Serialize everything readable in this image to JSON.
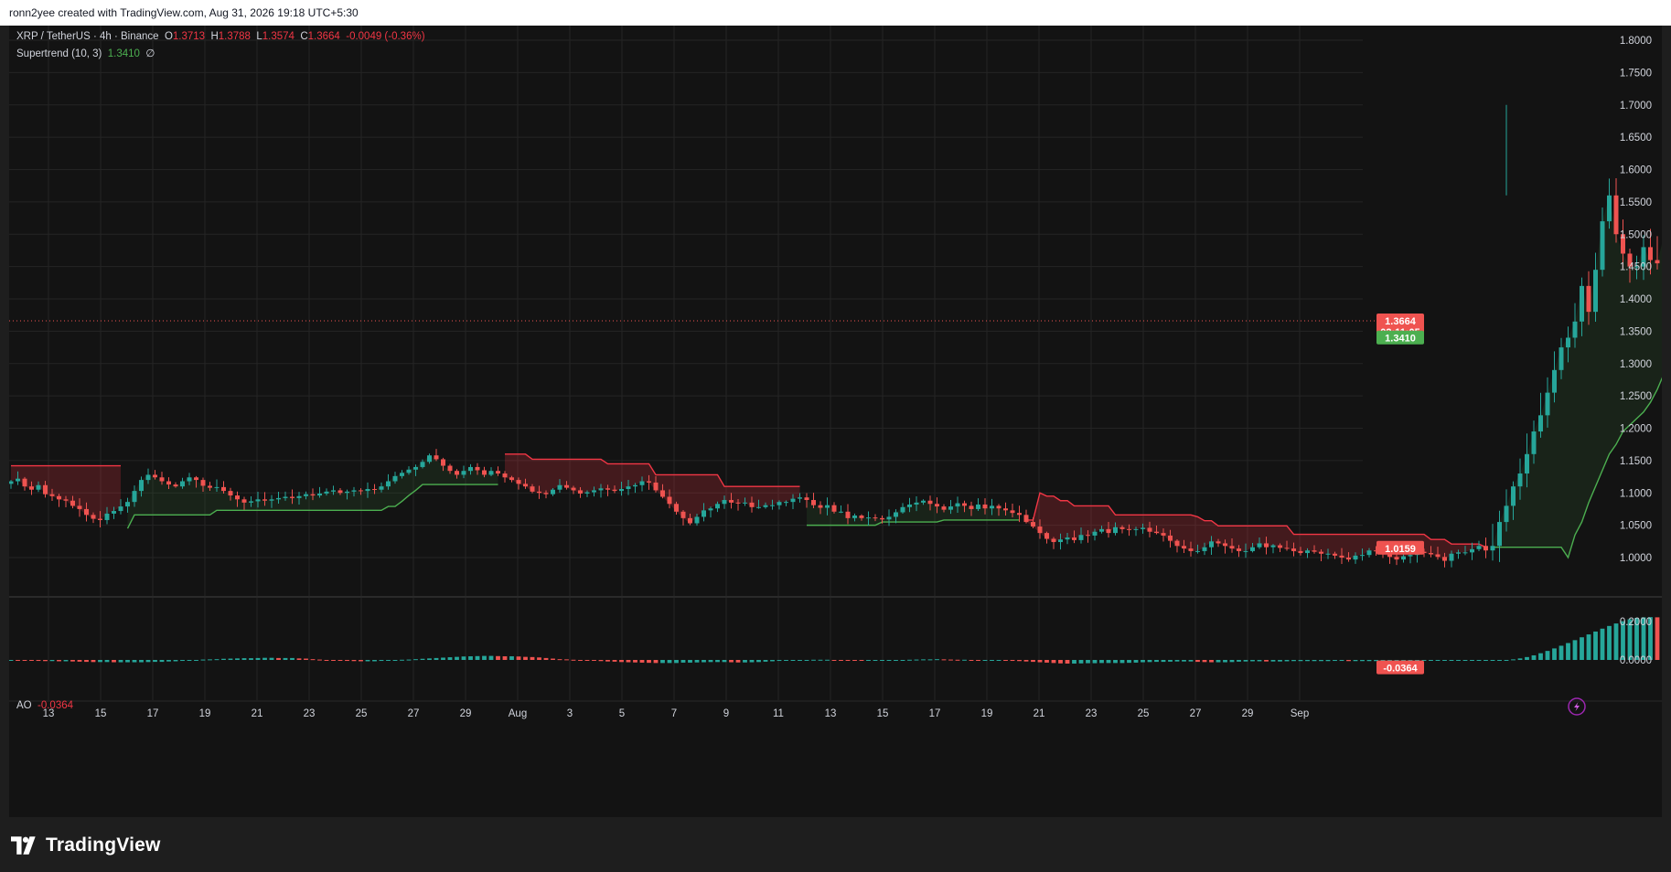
{
  "header": {
    "attribution": "ronn2yee created with TradingView.com, Aug 31, 2026 19:18 UTC+5:30"
  },
  "legend": {
    "symbol": "XRP / TetherUS · 4h · Binance",
    "open_label": "O",
    "open": "1.3713",
    "high_label": "H",
    "high": "1.3788",
    "low_label": "L",
    "low": "1.3574",
    "close_label": "C",
    "close": "1.3664",
    "change": "-0.0049 (-0.36%)",
    "indicator": "Supertrend (10, 3)",
    "indicator_value": "1.3410",
    "indicator_extra": "∅",
    "ao_label": "AO",
    "ao_value": "-0.0364"
  },
  "price_axis": {
    "ticks": [
      "1.8000",
      "1.7500",
      "1.7000",
      "1.6500",
      "1.6000",
      "1.5500",
      "1.5000",
      "1.4500",
      "1.4000",
      "1.3500",
      "1.3000",
      "1.2500",
      "1.2000",
      "1.1500",
      "1.1000",
      "1.0500",
      "1.0000"
    ],
    "last_price_label": "1.3664",
    "countdown": "02:11:05",
    "supertrend_label": "1.3410",
    "low_marker_label": "1.0159"
  },
  "ao_axis": {
    "ticks": [
      "0.2000",
      "0.0000"
    ],
    "current_label": "-0.0364"
  },
  "time_axis": {
    "labels": [
      "13",
      "15",
      "17",
      "19",
      "21",
      "23",
      "25",
      "27",
      "29",
      "Aug",
      "3",
      "5",
      "7",
      "9",
      "11",
      "13",
      "15",
      "17",
      "19",
      "21",
      "23",
      "25",
      "27",
      "29",
      "Sep"
    ]
  },
  "colors": {
    "up": "#26a69a",
    "down": "#ef5350",
    "supertrend_up": "#4caf50",
    "supertrend_down": "#f23645",
    "background": "#131313"
  },
  "brand": {
    "name": "TradingView"
  },
  "chart_data": {
    "type": "candlestick",
    "symbol": "XRP / TetherUS",
    "interval": "4h",
    "exchange": "Binance",
    "x_start": "Jul 12",
    "x_end": "Aug 31",
    "ylim": [
      0.95,
      1.82
    ],
    "series": [
      {
        "name": "XRP / TetherUS",
        "close": [
          1.118,
          1.122,
          1.11,
          1.105,
          1.112,
          1.098,
          1.095,
          1.09,
          1.088,
          1.08,
          1.075,
          1.066,
          1.06,
          1.058,
          1.068,
          1.072,
          1.079,
          1.086,
          1.103,
          1.12,
          1.128,
          1.124,
          1.118,
          1.113,
          1.11,
          1.118,
          1.124,
          1.12,
          1.111,
          1.108,
          1.109,
          1.103,
          1.096,
          1.09,
          1.085,
          1.087,
          1.09,
          1.088,
          1.09,
          1.092,
          1.094,
          1.092,
          1.095,
          1.098,
          1.096,
          1.099,
          1.102,
          1.104,
          1.1,
          1.102,
          1.104,
          1.103,
          1.106,
          1.105,
          1.11,
          1.118,
          1.126,
          1.131,
          1.136,
          1.14,
          1.148,
          1.158,
          1.152,
          1.142,
          1.134,
          1.128,
          1.134,
          1.14,
          1.135,
          1.128,
          1.134,
          1.13,
          1.124,
          1.12,
          1.114,
          1.11,
          1.102,
          1.1,
          1.098,
          1.105,
          1.112,
          1.108,
          1.104,
          1.099,
          1.101,
          1.104,
          1.107,
          1.105,
          1.103,
          1.106,
          1.11,
          1.112,
          1.118,
          1.116,
          1.104,
          1.094,
          1.083,
          1.071,
          1.061,
          1.053,
          1.063,
          1.073,
          1.076,
          1.083,
          1.089,
          1.085,
          1.084,
          1.085,
          1.078,
          1.078,
          1.081,
          1.081,
          1.086,
          1.086,
          1.091,
          1.093,
          1.089,
          1.081,
          1.077,
          1.081,
          1.071,
          1.071,
          1.061,
          1.065,
          1.061,
          1.062,
          1.061,
          1.059,
          1.063,
          1.07,
          1.078,
          1.082,
          1.085,
          1.088,
          1.083,
          1.079,
          1.074,
          1.079,
          1.084,
          1.08,
          1.075,
          1.082,
          1.076,
          1.08,
          1.076,
          1.073,
          1.069,
          1.066,
          1.055,
          1.048,
          1.038,
          1.029,
          1.024,
          1.028,
          1.031,
          1.027,
          1.035,
          1.034,
          1.04,
          1.044,
          1.038,
          1.047,
          1.044,
          1.043,
          1.044,
          1.046,
          1.04,
          1.038,
          1.034,
          1.026,
          1.018,
          1.014,
          1.01,
          1.01,
          1.016,
          1.025,
          1.022,
          1.018,
          1.014,
          1.01,
          1.01,
          1.016,
          1.022,
          1.016,
          1.019,
          1.015,
          1.014,
          1.01,
          1.007,
          1.011,
          1.009,
          1.006,
          1.006,
          1.003,
          1.0,
          0.997,
          1.003,
          1.004,
          1.011,
          1.01,
          1.005,
          1.001,
          0.997,
          1.002,
          1.004,
          1.009,
          1.007,
          1.005,
          1.001,
          0.995,
          1.006,
          1.008,
          1.008,
          1.013,
          1.018,
          1.011,
          1.018,
          1.055,
          1.08,
          1.11,
          1.13,
          1.16,
          1.195,
          1.22,
          1.255,
          1.29,
          1.325,
          1.34,
          1.365,
          1.42,
          1.38,
          1.445,
          1.52,
          1.56,
          1.5,
          1.47,
          1.45,
          1.45,
          1.48,
          1.46,
          1.455,
          1.5,
          1.475,
          1.48,
          1.51,
          1.48,
          1.51,
          1.495,
          1.52,
          1.5,
          1.52,
          1.49,
          1.48,
          1.465,
          1.462,
          1.42,
          1.41,
          1.39,
          1.38,
          1.35,
          1.365,
          1.39,
          1.4,
          1.42,
          1.46,
          1.47,
          1.45,
          1.44,
          1.43,
          1.4,
          1.37,
          1.38,
          1.385,
          1.378,
          1.385,
          1.39,
          1.38,
          1.395,
          1.4,
          1.398,
          1.403,
          1.395,
          1.405,
          1.385,
          1.41,
          1.355,
          1.35,
          1.36,
          1.371,
          1.366
        ]
      },
      {
        "name": "Supertrend (10, 3)",
        "values": [
          1.142,
          1.142,
          1.142,
          1.142,
          1.142,
          1.142,
          1.142,
          1.142,
          1.142,
          1.142,
          1.142,
          1.142,
          1.142,
          1.142,
          1.142,
          1.142,
          1.142,
          1.045,
          1.066,
          1.066,
          1.066,
          1.066,
          1.066,
          1.066,
          1.066,
          1.066,
          1.066,
          1.066,
          1.066,
          1.066,
          1.073,
          1.073,
          1.073,
          1.073,
          1.073,
          1.073,
          1.073,
          1.073,
          1.073,
          1.073,
          1.073,
          1.073,
          1.073,
          1.073,
          1.073,
          1.073,
          1.073,
          1.073,
          1.073,
          1.073,
          1.073,
          1.073,
          1.073,
          1.073,
          1.073,
          1.079,
          1.079,
          1.087,
          1.096,
          1.104,
          1.113,
          1.113,
          1.113,
          1.113,
          1.113,
          1.113,
          1.113,
          1.113,
          1.113,
          1.113,
          1.113,
          1.113,
          1.16,
          1.16,
          1.16,
          1.16,
          1.152,
          1.152,
          1.152,
          1.152,
          1.152,
          1.152,
          1.152,
          1.152,
          1.152,
          1.152,
          1.152,
          1.145,
          1.145,
          1.145,
          1.145,
          1.145,
          1.145,
          1.145,
          1.128,
          1.128,
          1.128,
          1.128,
          1.128,
          1.128,
          1.128,
          1.128,
          1.128,
          1.128,
          1.11,
          1.11,
          1.11,
          1.11,
          1.11,
          1.11,
          1.11,
          1.11,
          1.11,
          1.11,
          1.11,
          1.11,
          1.05,
          1.05,
          1.05,
          1.05,
          1.05,
          1.05,
          1.05,
          1.05,
          1.05,
          1.05,
          1.05,
          1.055,
          1.055,
          1.055,
          1.055,
          1.055,
          1.055,
          1.055,
          1.055,
          1.055,
          1.058,
          1.058,
          1.058,
          1.058,
          1.058,
          1.058,
          1.058,
          1.058,
          1.058,
          1.058,
          1.058,
          1.058,
          1.058,
          1.058,
          1.1,
          1.095,
          1.095,
          1.088,
          1.088,
          1.08,
          1.08,
          1.08,
          1.08,
          1.08,
          1.08,
          1.066,
          1.066,
          1.066,
          1.066,
          1.066,
          1.066,
          1.066,
          1.066,
          1.066,
          1.066,
          1.066,
          1.066,
          1.063,
          1.057,
          1.057,
          1.049,
          1.049,
          1.049,
          1.049,
          1.049,
          1.049,
          1.049,
          1.049,
          1.049,
          1.049,
          1.049,
          1.036,
          1.036,
          1.036,
          1.036,
          1.036,
          1.036,
          1.036,
          1.036,
          1.036,
          1.036,
          1.036,
          1.036,
          1.036,
          1.036,
          1.036,
          1.036,
          1.036,
          1.036,
          1.036,
          1.036,
          1.028,
          1.028,
          1.028,
          1.021,
          1.021,
          1.021,
          1.021,
          1.021,
          1.016,
          1.016,
          1.016,
          1.016,
          1.016,
          1.016,
          1.016,
          1.016,
          1.016,
          1.016,
          1.016,
          1.016,
          1.0,
          1.035,
          1.055,
          1.085,
          1.11,
          1.135,
          1.16,
          1.175,
          1.195,
          1.205,
          1.215,
          1.225,
          1.24,
          1.26,
          1.285,
          1.3,
          1.3,
          1.3,
          1.3,
          1.3,
          1.3,
          1.3,
          1.3,
          1.3,
          1.3,
          1.3,
          1.3,
          1.3,
          1.3,
          1.3,
          1.3,
          1.3,
          1.3,
          1.3,
          1.3,
          1.3,
          1.3,
          1.3,
          1.3,
          1.3,
          1.3,
          1.3,
          1.3,
          1.3,
          1.3,
          1.3,
          1.3,
          1.3,
          1.315,
          1.315,
          1.315,
          1.315,
          1.315,
          1.315,
          1.315,
          1.315,
          1.315,
          1.315,
          1.315,
          1.315,
          1.315,
          1.315,
          1.315,
          1.315,
          1.315,
          1.315,
          1.315,
          1.325,
          1.325,
          1.325,
          1.325,
          1.325,
          1.325,
          1.325,
          1.325,
          1.325,
          1.325,
          1.325,
          1.325,
          1.325,
          1.325,
          1.325,
          1.325,
          1.325,
          1.325,
          1.325,
          1.325,
          1.341,
          1.341,
          1.341,
          1.341,
          1.341,
          1.341
        ]
      },
      {
        "name": "AO",
        "values": [
          -0.001,
          -0.002,
          -0.003,
          -0.004,
          -0.005,
          -0.006,
          -0.006,
          -0.007,
          -0.007,
          -0.008,
          -0.009,
          -0.01,
          -0.011,
          -0.011,
          -0.011,
          -0.012,
          -0.012,
          -0.012,
          -0.012,
          -0.012,
          -0.011,
          -0.01,
          -0.01,
          -0.008,
          -0.007,
          -0.005,
          -0.002,
          0.0,
          0.002,
          0.003,
          0.004,
          0.006,
          0.007,
          0.008,
          0.009,
          0.009,
          0.01,
          0.011,
          0.011,
          0.01,
          0.01,
          0.01,
          0.008,
          0.007,
          0.004,
          0.002,
          0.0,
          -0.003,
          -0.004,
          -0.005,
          -0.006,
          -0.007,
          -0.007,
          -0.007,
          -0.005,
          -0.003,
          -0.001,
          0.001,
          0.002,
          0.004,
          0.006,
          0.008,
          0.01,
          0.012,
          0.014,
          0.016,
          0.018,
          0.019,
          0.02,
          0.021,
          0.021,
          0.02,
          0.019,
          0.019,
          0.018,
          0.016,
          0.015,
          0.013,
          0.01,
          0.007,
          0.004,
          0.003,
          0.001,
          -0.001,
          -0.003,
          -0.004,
          -0.006,
          -0.008,
          -0.009,
          -0.011,
          -0.012,
          -0.013,
          -0.014,
          -0.015,
          -0.016,
          -0.016,
          -0.016,
          -0.016,
          -0.014,
          -0.014,
          -0.013,
          -0.012,
          -0.011,
          -0.011,
          -0.011,
          -0.012,
          -0.013,
          -0.013,
          -0.012,
          -0.011,
          -0.009,
          -0.007,
          -0.005,
          -0.003,
          -0.001,
          0.0,
          0.0,
          0.001,
          0.001,
          0.001,
          0.0,
          -0.001,
          -0.002,
          -0.003,
          -0.004,
          -0.004,
          -0.003,
          -0.003,
          -0.002,
          -0.001,
          0.0,
          0.001,
          0.002,
          0.003,
          0.003,
          0.004,
          0.003,
          0.002,
          0.001,
          0.001,
          -0.001,
          -0.003,
          -0.003,
          -0.003,
          -0.003,
          -0.004,
          -0.005,
          -0.006,
          -0.008,
          -0.01,
          -0.012,
          -0.014,
          -0.016,
          -0.018,
          -0.019,
          -0.019,
          -0.018,
          -0.017,
          -0.017,
          -0.016,
          -0.016,
          -0.016,
          -0.016,
          -0.015,
          -0.014,
          -0.012,
          -0.011,
          -0.01,
          -0.01,
          -0.009,
          -0.008,
          -0.008,
          -0.008,
          -0.01,
          -0.011,
          -0.012,
          -0.012,
          -0.012,
          -0.011,
          -0.009,
          -0.008,
          -0.007,
          -0.007,
          -0.008,
          -0.008,
          -0.008,
          -0.007,
          -0.006,
          -0.006,
          -0.006,
          -0.006,
          -0.006,
          -0.006,
          -0.005,
          -0.005,
          -0.006,
          -0.006,
          -0.006,
          -0.006,
          -0.006,
          -0.005,
          -0.005,
          -0.005,
          -0.004,
          -0.004,
          -0.004,
          -0.004,
          -0.003,
          -0.003,
          -0.003,
          -0.003,
          -0.003,
          -0.002,
          -0.002,
          -0.002,
          -0.001,
          -0.001,
          -0.001,
          0.0,
          0.003,
          0.008,
          0.015,
          0.024,
          0.035,
          0.047,
          0.06,
          0.074,
          0.088,
          0.103,
          0.118,
          0.133,
          0.148,
          0.163,
          0.177,
          0.19,
          0.202,
          0.212,
          0.219,
          0.222,
          0.223,
          0.222,
          0.22,
          0.216,
          0.21,
          0.203,
          0.195,
          0.19,
          0.183,
          0.176,
          0.168,
          0.16,
          0.151,
          0.141,
          0.13,
          0.118,
          0.105,
          0.092,
          0.078,
          0.064,
          0.049,
          0.034,
          0.02,
          0.008,
          -0.004,
          -0.014,
          -0.023,
          -0.03,
          -0.035,
          -0.038,
          -0.04,
          -0.039,
          -0.036,
          -0.032,
          -0.027,
          -0.022,
          -0.017,
          -0.013,
          -0.01,
          -0.009,
          -0.01,
          -0.012,
          -0.015,
          -0.018,
          -0.021,
          -0.023,
          -0.025,
          -0.026,
          -0.026,
          -0.025,
          -0.023,
          -0.021,
          -0.019,
          -0.017,
          -0.015,
          -0.013,
          -0.012,
          -0.011,
          -0.011,
          -0.011,
          -0.012,
          -0.014,
          -0.017,
          -0.02,
          -0.024,
          -0.028,
          -0.032,
          -0.036
        ]
      }
    ]
  }
}
